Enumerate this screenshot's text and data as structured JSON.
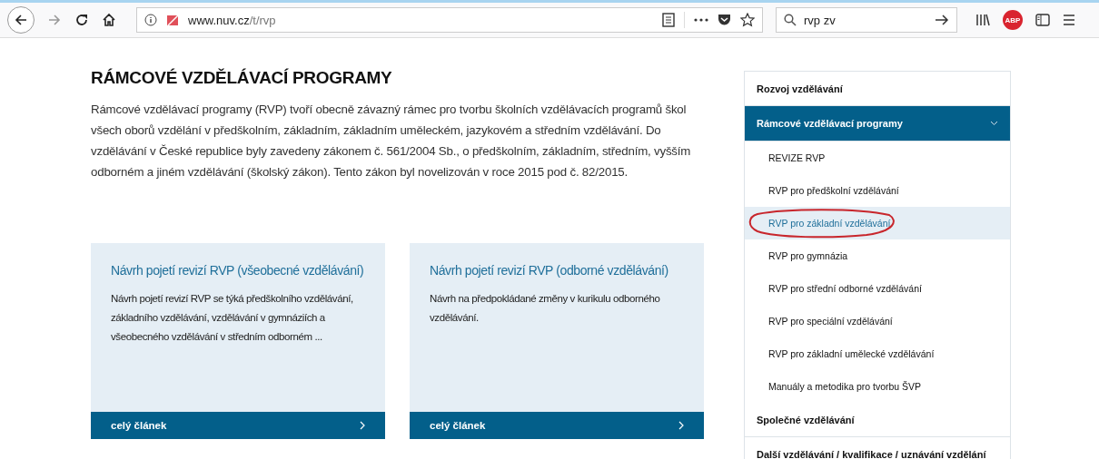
{
  "browser": {
    "url_host": "www.nuv.cz",
    "url_path": "/t/rvp",
    "search_value": "rvp zv",
    "adblock_label": "ABP"
  },
  "page": {
    "title": "RÁMCOVÉ VZDĚLÁVACÍ PROGRAMY",
    "intro": "Rámcové vzdělávací programy (RVP) tvoří obecně závazný rámec pro tvorbu školních vzdělávacích programů škol všech oborů vzdělání v předškolním, základním, základním uměleckém, jazykovém a středním vzdělávání.  Do vzdělávání v České republice byly zavedeny zákonem č. 561/2004 Sb., o předškolním, základním, středním, vyšším odborném a jiném vzdělávání (školský zákon). Tento zákon byl novelizován v roce 2015 pod č. 82/2015.",
    "cards": [
      {
        "title": "Návrh pojetí revizí RVP (všeobecné vzdělávání)",
        "text": "Návrh pojetí revizí RVP se týká předškolního vzdělávání, základního vzdělávání, vzdělávání v gymnáziích a všeobecného vzdělávání v středním odborném ...",
        "link": "celý článek"
      },
      {
        "title": "Návrh pojetí revizí RVP (odborné vzdělávání)",
        "text": "Návrh na předpokládané změny v kurikulu odborného vzdělávání.",
        "link": "celý článek"
      }
    ]
  },
  "sidebar": {
    "items": [
      {
        "label": "Rozvoj vzdělávání",
        "expanded": false
      },
      {
        "label": "Rámcové vzdělávací programy",
        "expanded": true,
        "children": [
          {
            "label": "REVIZE RVP",
            "selected": false,
            "circled": false
          },
          {
            "label": "RVP pro předškolní vzdělávání",
            "selected": false,
            "circled": false
          },
          {
            "label": "RVP pro základní vzdělávání",
            "selected": true,
            "circled": true
          },
          {
            "label": "RVP pro gymnázia",
            "selected": false,
            "circled": false
          },
          {
            "label": "RVP pro střední odborné vzdělávání",
            "selected": false,
            "circled": false
          },
          {
            "label": "RVP pro speciální vzdělávání",
            "selected": false,
            "circled": false
          },
          {
            "label": "RVP pro základní umělecké vzdělávání",
            "selected": false,
            "circled": false
          },
          {
            "label": "Manuály a metodika pro tvorbu ŠVP",
            "selected": false,
            "circled": false
          }
        ]
      },
      {
        "label": "Společné vzdělávání",
        "expanded": false
      },
      {
        "label": "Další vzdělávání / kvalifikace / uznávání vzdělání",
        "expanded": false
      }
    ]
  }
}
